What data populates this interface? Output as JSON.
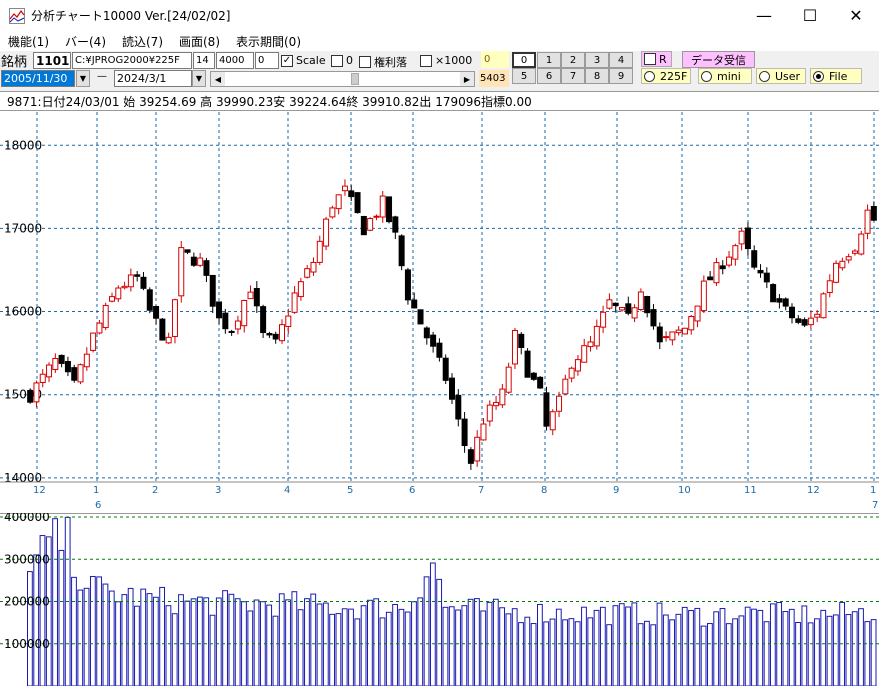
{
  "window": {
    "title": "分析チャート10000 Ver.[24/02/02]",
    "minimize_glyph": "—",
    "maximize_glyph": "☐",
    "close_glyph": "✕"
  },
  "menu": [
    "機能(1)",
    "バー(4)",
    "読込(7)",
    "画面(8)",
    "表示期間(0)"
  ],
  "toolbar": {
    "code_label": "銘柄",
    "code_value": "1101",
    "path_value": "C:¥JPROG2000¥225F",
    "field_a": "14",
    "field_b": "4000",
    "field_c": "0",
    "scale_label": "Scale",
    "zero_label": "0",
    "kenri_label": "権利落",
    "x1000_label": "×1000",
    "small_zero": "0",
    "counter": "5403",
    "num_buttons_row1": [
      "0",
      "1",
      "2",
      "3",
      "4"
    ],
    "num_buttons_row2": [
      "5",
      "6",
      "7",
      "8",
      "9"
    ],
    "r_label": "R",
    "data_recv_label": "データ受信",
    "radios": [
      "225F",
      "mini",
      "User",
      "File"
    ],
    "start_date": "2005/11/30",
    "dash": "—",
    "end_date": "2024/3/1"
  },
  "info_line": "9871:日付24/03/01 始 39254.69 高 39990.23安 39224.64終 39910.82出 179096指標0.00",
  "chart_data": [
    {
      "type": "candlestick",
      "y_ticks": [
        "18000",
        "17000",
        "16000",
        "15000",
        "14000"
      ],
      "ylim": [
        13950,
        18400
      ],
      "x_tick_labels": [
        "12",
        "1",
        "2",
        "3",
        "4",
        "5",
        "6",
        "7",
        "8",
        "9",
        "10",
        "11",
        "12",
        "1"
      ],
      "x_sub_labels": [
        "6",
        "7"
      ],
      "grid": true,
      "up_color": "#d40000",
      "down_color": "#000000",
      "close_path": [
        [
          0,
          15000
        ],
        [
          4,
          15400
        ],
        [
          7,
          15100
        ],
        [
          10,
          15700
        ],
        [
          14,
          16300
        ],
        [
          17,
          16400
        ],
        [
          19,
          16000
        ],
        [
          22,
          15600
        ],
        [
          24,
          16700
        ],
        [
          27,
          16600
        ],
        [
          30,
          15900
        ],
        [
          32,
          15800
        ],
        [
          35,
          16300
        ],
        [
          37,
          15700
        ],
        [
          39,
          15600
        ],
        [
          42,
          16200
        ],
        [
          45,
          16600
        ],
        [
          48,
          17300
        ],
        [
          50,
          17450
        ],
        [
          53,
          17000
        ],
        [
          56,
          17300
        ],
        [
          58,
          16900
        ],
        [
          60,
          16200
        ],
        [
          63,
          15700
        ],
        [
          66,
          15200
        ],
        [
          69,
          14400
        ],
        [
          70,
          14200
        ],
        [
          72,
          14700
        ],
        [
          75,
          15000
        ],
        [
          77,
          15700
        ],
        [
          79,
          15300
        ],
        [
          81,
          15000
        ],
        [
          82,
          14600
        ],
        [
          84,
          14900
        ],
        [
          86,
          15400
        ],
        [
          89,
          15600
        ],
        [
          92,
          16100
        ],
        [
          95,
          15900
        ],
        [
          97,
          16300
        ],
        [
          100,
          15600
        ],
        [
          102,
          15700
        ],
        [
          104,
          15800
        ],
        [
          107,
          16300
        ],
        [
          110,
          16600
        ],
        [
          113,
          16900
        ],
        [
          115,
          16500
        ],
        [
          117,
          16300
        ],
        [
          120,
          16000
        ],
        [
          123,
          15800
        ],
        [
          125,
          16000
        ],
        [
          128,
          16600
        ],
        [
          131,
          16800
        ],
        [
          133,
          17200
        ],
        [
          135,
          17000
        ]
      ],
      "candle_count": 135
    },
    {
      "type": "bar",
      "y_ticks": [
        "400000",
        "300000",
        "200000",
        "100000"
      ],
      "ylim": [
        0,
        400000
      ],
      "bar_color": "#1a1ab0",
      "grid_color": "#008000",
      "volume_path": [
        [
          0,
          280000
        ],
        [
          3,
          370000
        ],
        [
          6,
          370000
        ],
        [
          8,
          280000
        ],
        [
          10,
          250000
        ],
        [
          15,
          230000
        ],
        [
          20,
          220000
        ],
        [
          30,
          210000
        ],
        [
          40,
          210000
        ],
        [
          50,
          200000
        ],
        [
          60,
          200000
        ],
        [
          64,
          320000
        ],
        [
          66,
          200000
        ],
        [
          75,
          190000
        ],
        [
          85,
          185000
        ],
        [
          95,
          185000
        ],
        [
          105,
          180000
        ],
        [
          115,
          185000
        ],
        [
          125,
          180000
        ],
        [
          135,
          190000
        ]
      ],
      "bar_count": 135
    }
  ]
}
